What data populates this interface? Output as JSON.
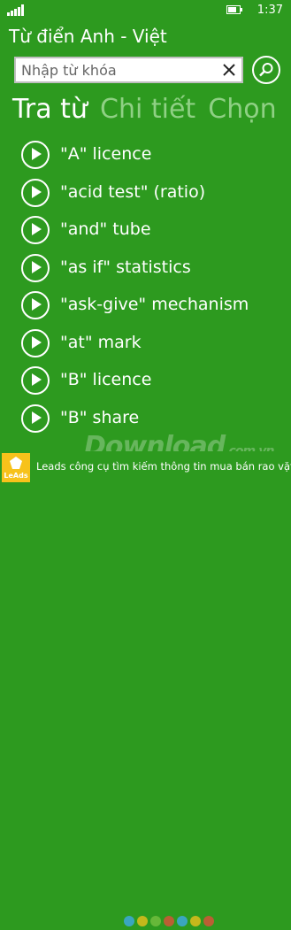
{
  "status_bar": {
    "time": "1:37"
  },
  "app": {
    "title": "Từ điển Anh - Việt"
  },
  "search": {
    "placeholder": "Nhập từ khóa",
    "value": ""
  },
  "pivot": {
    "tabs": [
      {
        "label": "Tra từ",
        "active": true
      },
      {
        "label": "Chi tiết",
        "active": false
      },
      {
        "label": "Chọn",
        "active": false
      }
    ]
  },
  "words": [
    {
      "label": "\"A\" licence"
    },
    {
      "label": "\"acid test\" (ratio)"
    },
    {
      "label": "\"and\" tube"
    },
    {
      "label": "\"as if\" statistics"
    },
    {
      "label": "\"ask-give\" mechanism"
    },
    {
      "label": "\"at\" mark"
    },
    {
      "label": "\"B\" licence"
    },
    {
      "label": "\"B\" share"
    }
  ],
  "ad": {
    "logo_text": "LeAds",
    "text": "Leads công cụ tìm kiếm thông tin mua bán rao vặt"
  },
  "watermark": {
    "main": "Download",
    "suffix": ".com.vn"
  },
  "colors": {
    "background": "#2d9a1f",
    "inactive_tab": "#8fd084",
    "ad_logo": "#f7c21b"
  }
}
